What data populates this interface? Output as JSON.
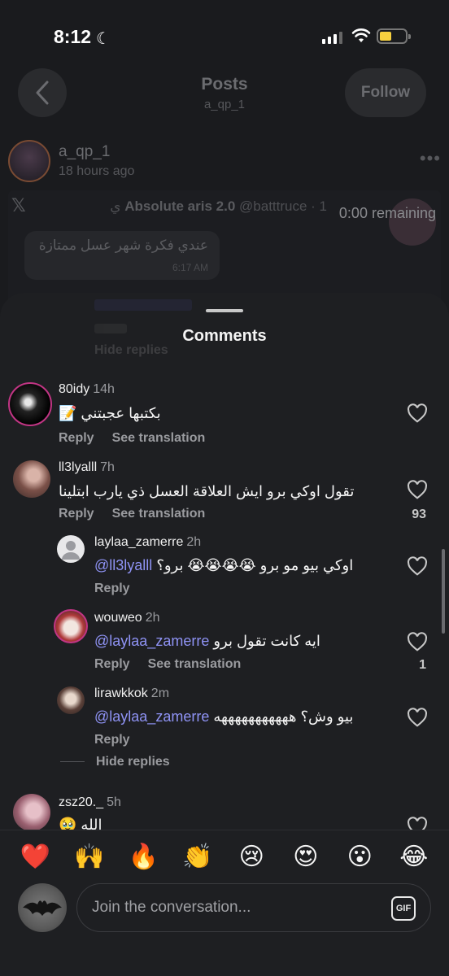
{
  "status_bar": {
    "time": "8:12"
  },
  "header": {
    "title": "Posts",
    "subtitle": "a_qp_1",
    "follow_label": "Follow"
  },
  "post": {
    "username": "a_qp_1",
    "time": "18 hours ago",
    "embed": {
      "handle_line": "@batttruce · 1 ي",
      "account_name": "Absolute aris 2.0",
      "remaining": "0:00 remaining",
      "dm_text": "عندي فكرة شهر عسل ممتازة",
      "dm_time": "6:17 AM"
    }
  },
  "sheet": {
    "title": "Comments",
    "ghost_hide_replies": "Hide replies",
    "comments": [
      {
        "username": "80idy",
        "time": "14h",
        "text": "بكتبها عجبتني 📝",
        "reply": "Reply",
        "translate": "See translation",
        "likes": ""
      },
      {
        "username": "ll3lyalll",
        "time": "7h",
        "text": "تقول اوكي برو ايش العلاقة العسل ذي يارب ابتلينا",
        "reply": "Reply",
        "translate": "See translation",
        "likes": "93"
      },
      {
        "username": "laylaa_zamerre",
        "time": "2h",
        "mention": "@ll3lyalll",
        "text": "اوكي بيو مو برو 😭😭😭😭 برو؟",
        "reply": "Reply",
        "likes": ""
      },
      {
        "username": "wouweo",
        "time": "2h",
        "mention": "@laylaa_zamerre",
        "text": "ايه كانت تقول برو",
        "reply": "Reply",
        "translate": "See translation",
        "likes": "1"
      },
      {
        "username": "lirawkkok",
        "time": "2m",
        "mention": "@laylaa_zamerre",
        "text": "بيو وش؟ هههههههههههه",
        "reply": "Reply",
        "likes": ""
      },
      {
        "username": "zsz20._",
        "time": "5h",
        "text": "الله 🥹",
        "likes": ""
      }
    ],
    "hide_replies": "Hide replies"
  },
  "reactions": [
    "❤️",
    "🙌",
    "🔥",
    "👏",
    "😢",
    "😍",
    "😮",
    "😂"
  ],
  "composer": {
    "placeholder": "Join the conversation...",
    "gif_label": "GIF"
  },
  "colors": {
    "mention": "#8f93f5",
    "sheet_bg": "#1e1f22"
  }
}
